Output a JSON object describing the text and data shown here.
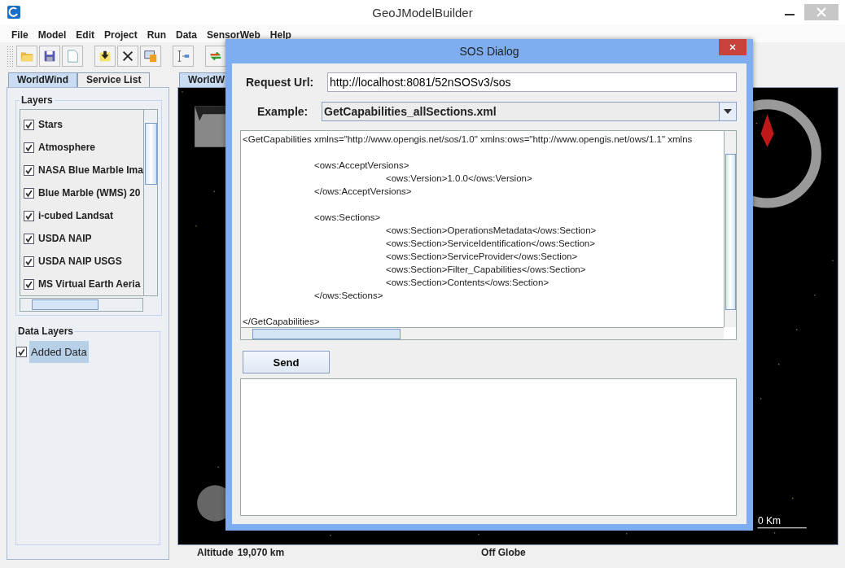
{
  "window": {
    "title": "GeoJModelBuilder"
  },
  "menu": [
    "File",
    "Model",
    "Edit",
    "Project",
    "Run",
    "Data",
    "SensorWeb",
    "Help"
  ],
  "left_tabs": [
    {
      "label": "WorldWind",
      "selected": true
    },
    {
      "label": "Service List",
      "selected": false
    }
  ],
  "layers": {
    "title": "Layers",
    "items": [
      {
        "label": "Stars",
        "checked": true
      },
      {
        "label": "Atmosphere",
        "checked": true
      },
      {
        "label": "NASA Blue Marble Ima",
        "checked": true
      },
      {
        "label": "Blue Marble (WMS) 20",
        "checked": true
      },
      {
        "label": "i-cubed Landsat",
        "checked": true
      },
      {
        "label": "USDA NAIP",
        "checked": true
      },
      {
        "label": "USDA NAIP USGS",
        "checked": true
      },
      {
        "label": "MS Virtual Earth Aeria",
        "checked": true
      }
    ]
  },
  "data_layers": {
    "title": "Data Layers",
    "items": [
      {
        "label": "Added Data",
        "checked": true,
        "selected": true
      }
    ]
  },
  "view_tab": {
    "label": "WorldW",
    "selected": true
  },
  "scale_label": "0 Km",
  "status_bar": {
    "altitude_label": "Altitude",
    "altitude": "19,070 km",
    "position": "Off Globe"
  },
  "dialog": {
    "title": "SOS Dialog",
    "request_url_label": "Request Url:",
    "request_url": "http://localhost:8081/52nSOSv3/sos",
    "example_label": "Example:",
    "example": "GetCapabilities_allSections.xml",
    "request": {
      "open": "<GetCapabilities xmlns=\"http://www.opengis.net/sos/1.0\" xmlns:ows=\"http://www.opengis.net/ows/1.1\" xmlns",
      "close": "</GetCapabilities>",
      "children": [
        {
          "open": "<ows:AcceptVersions>",
          "close": "</ows:AcceptVersions>",
          "children": [
            {
              "open": "<ows:Version>1.0.0</ows:Version>"
            }
          ]
        },
        {
          "open": "<ows:Sections>",
          "close": "</ows:Sections>",
          "children": [
            {
              "open": "<ows:Section>OperationsMetadata</ows:Section>"
            },
            {
              "open": "<ows:Section>ServiceIdentification</ows:Section>"
            },
            {
              "open": "<ows:Section>ServiceProvider</ows:Section>"
            },
            {
              "open": "<ows:Section>Filter_Capabilities</ows:Section>"
            },
            {
              "open": "<ows:Section>Contents</ows:Section>"
            }
          ]
        }
      ]
    },
    "send_button": "Send"
  }
}
